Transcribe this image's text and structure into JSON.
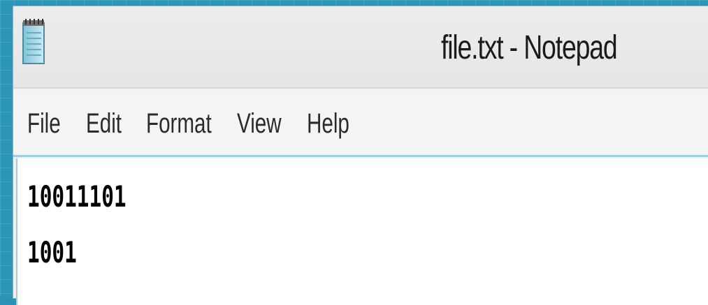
{
  "window": {
    "title": "file.txt - Notepad",
    "app_icon": "notepad-icon"
  },
  "menu": {
    "items": [
      {
        "label": "File"
      },
      {
        "label": "Edit"
      },
      {
        "label": "Format"
      },
      {
        "label": "View"
      },
      {
        "label": "Help"
      }
    ]
  },
  "editor": {
    "lines": [
      "10011101",
      "1001"
    ]
  },
  "colors": {
    "desktop": "#2b97b8",
    "titlebar": "#ededed",
    "menubar": "#f4f4f4",
    "editor_bg": "#ffffff",
    "accent_border": "#9ecbe6"
  }
}
